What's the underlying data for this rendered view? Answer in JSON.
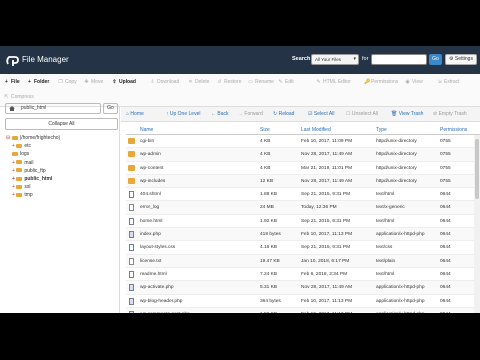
{
  "header": {
    "title": "File Manager",
    "search_label": "Search",
    "search_scope": "All Your Files",
    "for_label": "for",
    "search_placeholder": "",
    "go_label": "Go",
    "settings_label": "Settings"
  },
  "toolbar": {
    "row1": [
      {
        "icon": "plus-icon",
        "label": "File",
        "enabled": true
      },
      {
        "icon": "plus-icon",
        "label": "Folder",
        "enabled": true
      },
      {
        "icon": "copy-icon",
        "label": "Copy",
        "enabled": false
      },
      {
        "icon": "move-icon",
        "label": "Move",
        "enabled": false
      },
      {
        "icon": "upload-icon",
        "label": "Upload",
        "enabled": true
      },
      {
        "icon": "download-icon",
        "label": "Download",
        "enabled": false
      },
      {
        "icon": "delete-icon",
        "label": "Delete",
        "enabled": false
      },
      {
        "icon": "restore-icon",
        "label": "Restore",
        "enabled": false
      },
      {
        "icon": "rename-icon",
        "label": "Rename",
        "enabled": false
      },
      {
        "icon": "edit-icon",
        "label": "Edit",
        "enabled": false
      },
      {
        "icon": "html-editor-icon",
        "label": "HTML Editor",
        "enabled": false
      },
      {
        "icon": "permissions-icon",
        "label": "Permissions",
        "enabled": false
      },
      {
        "icon": "view-icon",
        "label": "View",
        "enabled": false
      },
      {
        "icon": "extract-icon",
        "label": "Extract",
        "enabled": false
      }
    ],
    "row2": [
      {
        "icon": "compress-icon",
        "label": "Compress",
        "enabled": false
      }
    ]
  },
  "sidebar": {
    "path_value": "public_html",
    "go_label": "Go",
    "collapse_label": "Collapse All",
    "tree": [
      {
        "label": "(/home/frightecho)",
        "level": 0,
        "bold": false,
        "prefix": "⊟"
      },
      {
        "label": "etc",
        "level": 1,
        "bold": false,
        "prefix": "+"
      },
      {
        "label": "logs",
        "level": 1,
        "bold": false,
        "prefix": ""
      },
      {
        "label": "mail",
        "level": 1,
        "bold": false,
        "prefix": "+"
      },
      {
        "label": "public_ftp",
        "level": 1,
        "bold": false,
        "prefix": "+"
      },
      {
        "label": "public_html",
        "level": 1,
        "bold": true,
        "prefix": "+"
      },
      {
        "label": "ssl",
        "level": 1,
        "bold": false,
        "prefix": "+"
      },
      {
        "label": "tmp",
        "level": 1,
        "bold": false,
        "prefix": "+"
      }
    ]
  },
  "nav": [
    {
      "icon": "home-icon",
      "label": "Home",
      "enabled": true
    },
    {
      "icon": "up-level-icon",
      "label": "Up One Level",
      "enabled": true
    },
    {
      "icon": "back-icon",
      "label": "Back",
      "enabled": true
    },
    {
      "icon": "forward-icon",
      "label": "Forward",
      "enabled": false
    },
    {
      "icon": "reload-icon",
      "label": "Reload",
      "enabled": true
    },
    {
      "icon": "select-all-icon",
      "label": "Select All",
      "enabled": true
    },
    {
      "icon": "unselect-all-icon",
      "label": "Unselect All",
      "enabled": false
    },
    {
      "icon": "trash-icon",
      "label": "View Trash",
      "enabled": true
    },
    {
      "icon": "empty-trash-icon",
      "label": "Empty Trash",
      "enabled": false
    }
  ],
  "table": {
    "columns": [
      "Name",
      "Size",
      "Last Modified",
      "Type",
      "Permissions"
    ],
    "rows": [
      {
        "kind": "folder",
        "name": "cgi-bin",
        "size": "4 KB",
        "modified": "Feb 10, 2017, 11:09 PM",
        "type": "httpd/unix-directory",
        "perms": "0755"
      },
      {
        "kind": "folder",
        "name": "wp-admin",
        "size": "4 KB",
        "modified": "Nov 28, 2017, 11:49 AM",
        "type": "httpd/unix-directory",
        "perms": "0755"
      },
      {
        "kind": "folder",
        "name": "wp-content",
        "size": "4 KB",
        "modified": "Mar 21, 2019, 11:01 PM",
        "type": "httpd/unix-directory",
        "perms": "0755"
      },
      {
        "kind": "folder",
        "name": "wp-includes",
        "size": "12 KB",
        "modified": "Nov 28, 2017, 11:49 AM",
        "type": "httpd/unix-directory",
        "perms": "0755"
      },
      {
        "kind": "file",
        "name": "404.shtml",
        "size": "1.88 KB",
        "modified": "Sep 21, 2015, 9:31 PM",
        "type": "text/html",
        "perms": "0644"
      },
      {
        "kind": "text",
        "name": "error_log",
        "size": "24 MB",
        "modified": "Today, 12:36 PM",
        "type": "text/x-generic",
        "perms": "0644"
      },
      {
        "kind": "file",
        "name": "home.html",
        "size": "1.92 KB",
        "modified": "Sep 21, 2015, 9:31 PM",
        "type": "text/html",
        "perms": "0644"
      },
      {
        "kind": "code",
        "name": "index.php",
        "size": "418 bytes",
        "modified": "Feb 10, 2017, 11:13 PM",
        "type": "application/x-httpd-php",
        "perms": "0644"
      },
      {
        "kind": "file",
        "name": "layout-styles.css",
        "size": "4.16 KB",
        "modified": "Sep 21, 2015, 9:31 PM",
        "type": "text/css",
        "perms": "0644"
      },
      {
        "kind": "text",
        "name": "license.txt",
        "size": "19.47 KB",
        "modified": "Jan 10, 2018, 6:17 PM",
        "type": "text/plain",
        "perms": "0644"
      },
      {
        "kind": "file",
        "name": "readme.html",
        "size": "7.24 KB",
        "modified": "Feb 6, 2018, 2:34 PM",
        "type": "text/html",
        "perms": "0644"
      },
      {
        "kind": "code",
        "name": "wp-activate.php",
        "size": "5.31 KB",
        "modified": "Nov 28, 2017, 11:49 AM",
        "type": "application/x-httpd-php",
        "perms": "0644"
      },
      {
        "kind": "code",
        "name": "wp-blog-header.php",
        "size": "364 bytes",
        "modified": "Feb 10, 2017, 11:13 PM",
        "type": "application/x-httpd-php",
        "perms": "0644"
      },
      {
        "kind": "code",
        "name": "wp-comments-post.php",
        "size": "1.59 KB",
        "modified": "Feb 10, 2017, 11:13 PM",
        "type": "application/x-httpd-php",
        "perms": "0644"
      }
    ]
  },
  "colors": {
    "topbar": "#243446",
    "accent": "#2a6fb5",
    "folder": "#e8a838"
  }
}
